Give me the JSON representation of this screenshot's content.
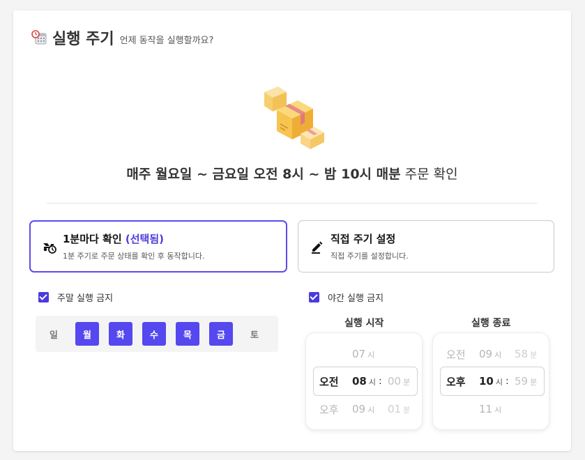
{
  "header": {
    "title": "실행 주기",
    "subtitle": "언제 동작을 실행할까요?"
  },
  "summary": {
    "bold": "매주 월요일 ~ 금요일 오전 8시 ~ 밤 10시 매분",
    "normal": " 주문 확인"
  },
  "options": [
    {
      "title": "1분마다 확인",
      "selected_tag": " (선택됨)",
      "desc": "1분 주기로 주문 상태를 확인 후 동작합니다.",
      "icon": "moped-clock-icon"
    },
    {
      "title": "직접 주기 설정",
      "desc": "직접 주기를 설정합니다.",
      "icon": "pencil-icon"
    }
  ],
  "weekend": {
    "label": "주말 실행 금지",
    "checked": true
  },
  "night": {
    "label": "야간 실행 금지",
    "checked": true
  },
  "days": [
    {
      "label": "일",
      "active": false
    },
    {
      "label": "월",
      "active": true
    },
    {
      "label": "화",
      "active": true
    },
    {
      "label": "수",
      "active": true
    },
    {
      "label": "목",
      "active": true
    },
    {
      "label": "금",
      "active": true
    },
    {
      "label": "토",
      "active": false
    }
  ],
  "start": {
    "label": "실행 시작",
    "prev": {
      "hour": "07",
      "hour_unit": "시"
    },
    "current": {
      "ampm": "오전",
      "hour": "08",
      "hour_unit": "시",
      "colon": ":",
      "minute": "00",
      "minute_unit": "분"
    },
    "next": {
      "ampm": "오후",
      "hour": "09",
      "hour_unit": "시",
      "minute": "01",
      "minute_unit": "분"
    }
  },
  "end": {
    "label": "실행 종료",
    "prev": {
      "ampm": "오전",
      "hour": "09",
      "hour_unit": "시",
      "minute": "58",
      "minute_unit": "분"
    },
    "current": {
      "ampm": "오후",
      "hour": "10",
      "hour_unit": "시",
      "colon": ":",
      "minute": "59",
      "minute_unit": "분"
    },
    "next": {
      "hour": "11",
      "hour_unit": "시"
    }
  },
  "colors": {
    "accent": "#5548ef",
    "selected_text": "#4b3bdc",
    "box": "#f7c65a"
  }
}
